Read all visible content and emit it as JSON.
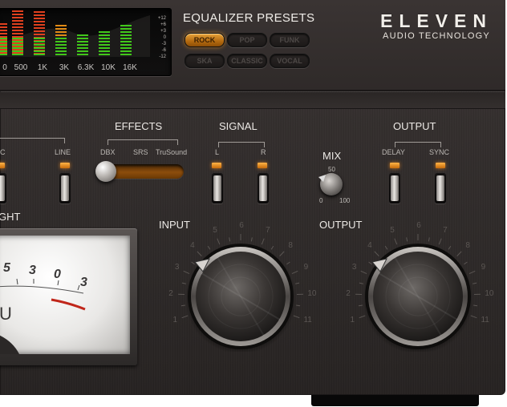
{
  "colors": {
    "accent_amber": "#f0a43c",
    "panel_dark": "#2f2a29",
    "eq_green": "#41c71b",
    "eq_red": "#e83b1f",
    "eq_orange": "#e08a16",
    "meter_needle": "#c0261a"
  },
  "spectrum": {
    "freqs": [
      "0",
      "500",
      "1K",
      "3K",
      "6.3K",
      "10K",
      "16K"
    ],
    "db_scale": [
      "+12",
      "+6",
      "+3",
      "0",
      "-3",
      "-6",
      "-12"
    ]
  },
  "presets": {
    "title": "EQUALIZER PRESETS",
    "items": [
      {
        "label": "ROCK",
        "active": true
      },
      {
        "label": "POP",
        "active": false
      },
      {
        "label": "FUNK",
        "active": false
      },
      {
        "label": "SKA",
        "active": false
      },
      {
        "label": "CLASSIC",
        "active": false
      },
      {
        "label": "VOCAL",
        "active": false
      }
    ]
  },
  "brand": {
    "name": "ELEVEN",
    "subtitle": "AUDIO TECHNOLOGY"
  },
  "left_group": {
    "partial_label": "C",
    "line_label": "LINE",
    "partial_title": "GHT"
  },
  "effects": {
    "title": "EFFECTS",
    "options": [
      "DBX",
      "SRS",
      "TruSound"
    ],
    "selected": "DBX"
  },
  "signal": {
    "title": "SIGNAL",
    "left": "L",
    "right": "R"
  },
  "mix": {
    "title": "MIX",
    "mid": "50",
    "min": "0",
    "max": "100"
  },
  "output_group": {
    "title": "OUTPUT",
    "delay": "DELAY",
    "sync": "SYNC"
  },
  "knobs": {
    "input_label": "INPUT",
    "output_label": "OUTPUT",
    "scale": [
      "1",
      "2",
      "3",
      "4",
      "5",
      "6",
      "7",
      "8",
      "9",
      "10",
      "11"
    ]
  },
  "vu_meter": {
    "scale": [
      "5",
      "3",
      "0",
      "3"
    ],
    "unit": "U"
  }
}
